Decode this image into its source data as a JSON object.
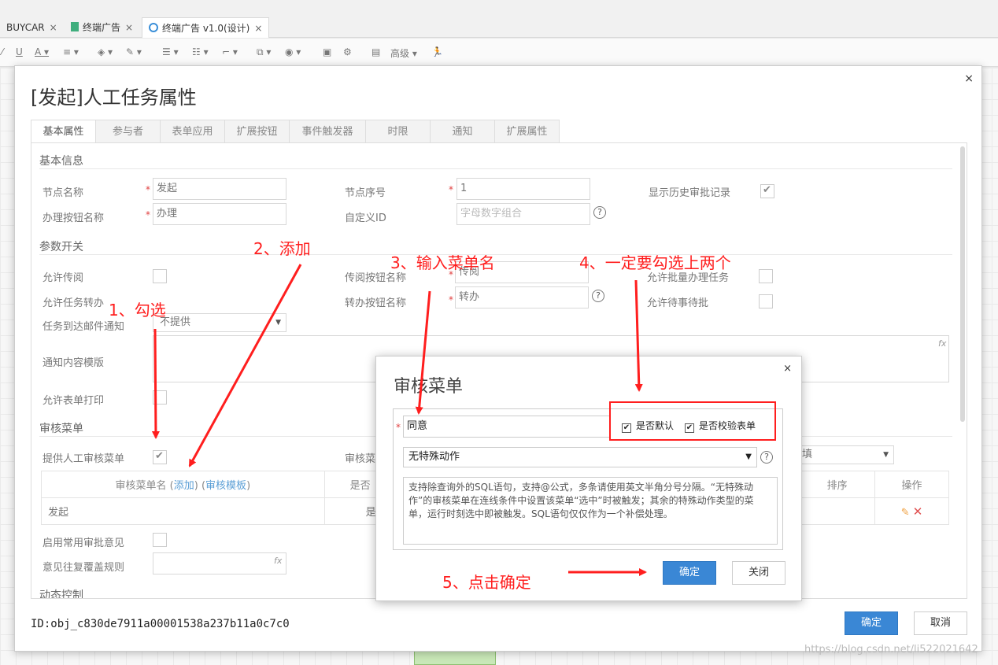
{
  "app_tabs": [
    {
      "label": "BUYCAR"
    },
    {
      "label": "终端广告"
    },
    {
      "label": "终端广告 v1.0(设计)"
    }
  ],
  "toolbar": {
    "advanced_label": "高级"
  },
  "dialog": {
    "title": "[发起]人工任务属性",
    "close": "×",
    "tabs": [
      "基本属性",
      "参与者",
      "表单应用",
      "扩展按钮",
      "事件触发器",
      "时限",
      "通知",
      "扩展属性"
    ],
    "sections": {
      "basic": "基本信息",
      "params": "参数开关",
      "audit_menu": "审核菜单",
      "dynamic": "动态控制"
    },
    "fields": {
      "node_name_label": "节点名称",
      "node_name_value": "发起",
      "node_seq_label": "节点序号",
      "node_seq_value": "1",
      "show_history_label": "显示历史审批记录",
      "handle_btn_label": "办理按钮名称",
      "handle_btn_value": "办理",
      "custom_id_label": "自定义ID",
      "custom_id_placeholder": "字母数字组合",
      "allow_pass_label": "允许传阅",
      "pass_btn_label": "传阅按钮名称",
      "pass_btn_value": "传阅",
      "batch_label": "允许批量办理任务",
      "transfer_label": "允许任务转办",
      "transfer_btn_label": "转办按钮名称",
      "transfer_btn_value": "转办",
      "pending_label": "允许待事待批",
      "mail_notify_label": "任务到达邮件通知",
      "mail_notify_value": "不提供",
      "notify_tpl_label": "通知内容模版",
      "print_label": "允许表单打印",
      "provide_menu_label": "提供人工审核菜单",
      "audit_menu_label_2": "审核菜",
      "common_opinion_label": "启用常用审批意见",
      "opinion_rule_label": "意见往复覆盖规则",
      "right_select_value": "填"
    },
    "table": {
      "col_name": "审核菜单名",
      "add_link": "添加",
      "tpl_link": "审核模板",
      "col_default": "是否",
      "col_sort": "排序",
      "col_ops": "操作",
      "rows": [
        {
          "name": "发起",
          "default": "是"
        }
      ]
    },
    "footer_id": "ID:obj_c830de7911a00001538a237b11a0c7c0",
    "ok": "确定",
    "cancel": "取消"
  },
  "sub_dialog": {
    "title": "审核菜单",
    "close": "×",
    "menu_name_value": "同意",
    "is_default_label": "是否默认",
    "validate_form_label": "是否校验表单",
    "action_value": "无特殊动作",
    "description": "支持除查询外的SQL语句，支持@公式，多条请使用英文半角分号分隔。“无特殊动作”的审核菜单在连线条件中设置该菜单“选中”时被触发；其余的特殊动作类型的菜单，运行时刻选中即被触发。SQL语句仅仅作为一个补偿处理。",
    "ok": "确定",
    "close_btn": "关闭"
  },
  "annotations": {
    "step1": "1、勾选",
    "step2": "2、添加",
    "step3": "3、输入菜单名",
    "step4": "4、一定要勾选上两个",
    "step5": "5、点击确定",
    "color": "#ff1e1e"
  },
  "watermark": "https://blog.csdn.net/li522021642"
}
